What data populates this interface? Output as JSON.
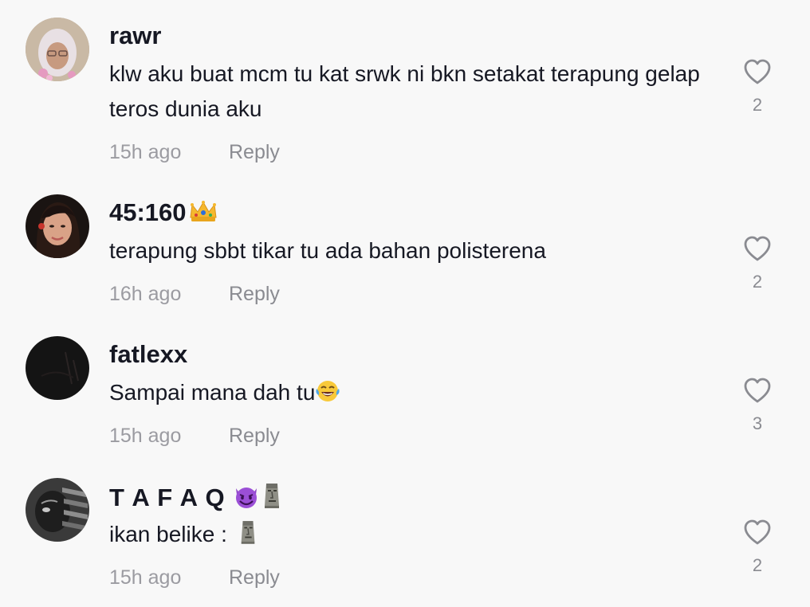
{
  "comments": [
    {
      "username": "rawr",
      "text": "klw aku buat mcm tu kat srwk ni bkn setakat terapung gelap teros dunia aku",
      "time": "15h ago",
      "reply_label": "Reply",
      "likes": "2",
      "avatar": "avatar-rawr"
    },
    {
      "username": "45:160",
      "username_emoji": "crown-emoji",
      "text": "terapung sbbt tikar tu ada bahan polisterena",
      "time": "16h ago",
      "reply_label": "Reply",
      "likes": "2",
      "avatar": "avatar-45-160"
    },
    {
      "username": "fatlexx",
      "text": "Sampai mana dah tu",
      "text_emoji": "laughing-tears-emoji",
      "time": "15h ago",
      "reply_label": "Reply",
      "likes": "3",
      "avatar": "avatar-fatlexx"
    },
    {
      "username": "T A F A Q",
      "username_emoji": [
        "smiling-devil-emoji",
        "moai-emoji"
      ],
      "text": "ikan belike : ",
      "text_emoji": "moai-emoji",
      "time": "15h ago",
      "reply_label": "Reply",
      "likes": "2",
      "avatar": "avatar-tafaq"
    }
  ],
  "icons": {
    "like": "heart-outline-icon"
  },
  "colors": {
    "background": "#f8f8f8",
    "primary_text": "#161823",
    "secondary_text": "#9b9ba1",
    "icon": "#8a8b91"
  }
}
